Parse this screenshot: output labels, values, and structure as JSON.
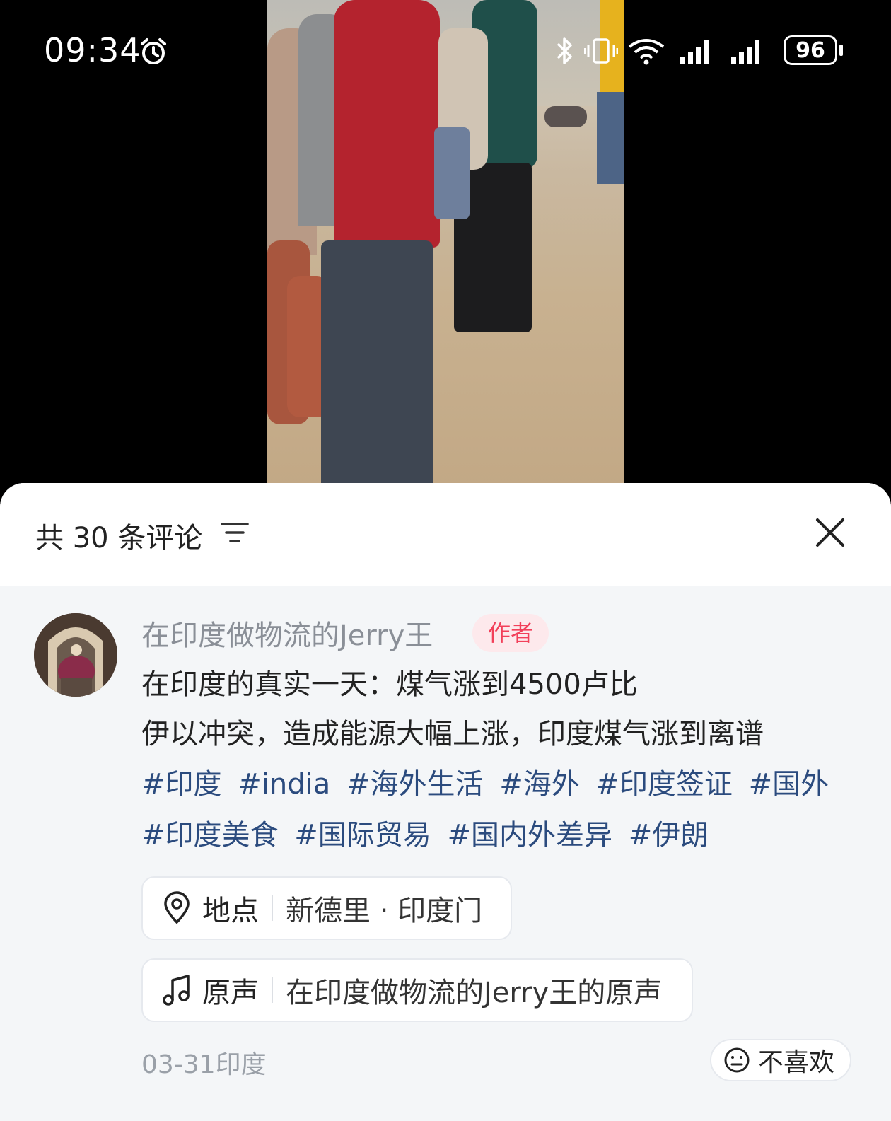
{
  "status_bar": {
    "time": "09:34",
    "battery": "96",
    "icons": [
      "alarm-icon",
      "bluetooth-icon",
      "vibrate-icon",
      "wifi-icon",
      "signal-icon",
      "signal-icon",
      "battery-icon"
    ]
  },
  "comments": {
    "count_label": "共 30 条评论",
    "filter_icon": "filter-icon",
    "close_icon": "close-icon"
  },
  "post": {
    "author": "在印度做物流的Jerry王",
    "author_badge": "作者",
    "title_line": "在印度的真实一天：煤气涨到4500卢比",
    "body_line": "伊以冲突，造成能源大幅上涨，印度煤气涨到离谱",
    "tags": [
      "#印度",
      "#india",
      "#海外生活",
      "#海外",
      "#印度签证",
      "#国外",
      "#印度美食",
      "#国际贸易",
      "#国内外差异",
      "#伊朗"
    ],
    "location": {
      "label": "地点",
      "value": "新德里 · 印度门",
      "icon": "location-pin-icon"
    },
    "sound": {
      "label": "原声",
      "value": "在印度做物流的Jerry王的原声",
      "icon": "music-note-icon"
    },
    "date_region": "03-31印度",
    "dislike": {
      "label": "不喜欢",
      "icon": "neutral-face-icon"
    }
  },
  "colors": {
    "accent_badge": "#f2405a",
    "tag_link": "#2b4b7e",
    "sheet_bg": "#f4f6f8"
  }
}
